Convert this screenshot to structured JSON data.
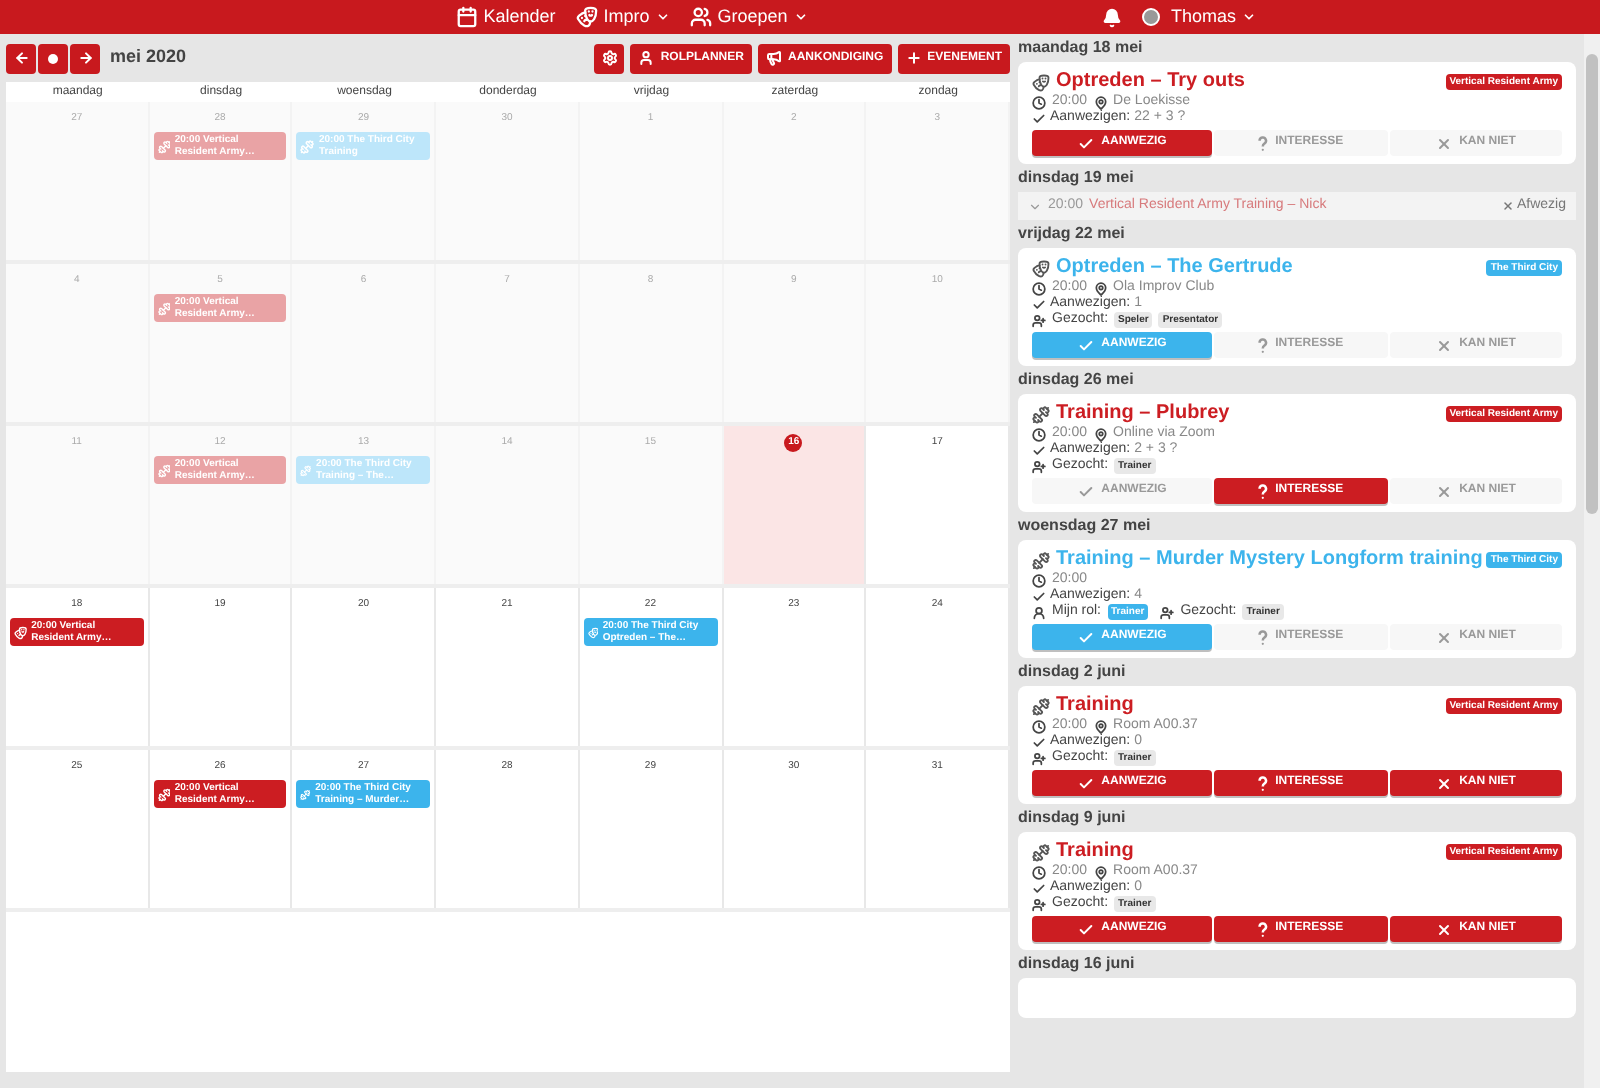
{
  "navbar": {
    "items": [
      {
        "label": "Kalender",
        "dropdown": false
      },
      {
        "label": "Impro",
        "dropdown": true
      },
      {
        "label": "Groepen",
        "dropdown": true
      }
    ],
    "user": {
      "name": "Thomas"
    }
  },
  "toolbar": {
    "month": "mei 2020",
    "buttons": [
      {
        "label": "ROLPLANNER"
      },
      {
        "label": "AANKONDIGING"
      },
      {
        "label": "EVENEMENT"
      }
    ]
  },
  "calendar": {
    "weekdays": [
      "maandag",
      "dinsdag",
      "woensdag",
      "donderdag",
      "vrijdag",
      "zaterdag",
      "zondag"
    ],
    "weeks": [
      [
        {
          "day": "27",
          "past": true,
          "today": false
        },
        {
          "day": "28",
          "past": true,
          "today": false,
          "events": [
            {
              "kind": "training",
              "text": "20:00 Vertical Resident Army…",
              "color": "#e9a3a5"
            }
          ]
        },
        {
          "day": "29",
          "past": true,
          "today": false,
          "events": [
            {
              "kind": "training",
              "text": "20:00 The Third City Training",
              "color": "#bde6fa"
            }
          ]
        },
        {
          "day": "30",
          "past": true,
          "today": false
        },
        {
          "day": "1",
          "past": true,
          "today": false
        },
        {
          "day": "2",
          "past": true,
          "today": false
        },
        {
          "day": "3",
          "past": true,
          "today": false
        }
      ],
      [
        {
          "day": "4",
          "past": true,
          "today": false
        },
        {
          "day": "5",
          "past": true,
          "today": false,
          "events": [
            {
              "kind": "training",
              "text": "20:00 Vertical Resident Army…",
              "color": "#e9a3a5"
            }
          ]
        },
        {
          "day": "6",
          "past": true,
          "today": false
        },
        {
          "day": "7",
          "past": true,
          "today": false
        },
        {
          "day": "8",
          "past": true,
          "today": false
        },
        {
          "day": "9",
          "past": true,
          "today": false
        },
        {
          "day": "10",
          "past": true,
          "today": false
        }
      ],
      [
        {
          "day": "11",
          "past": true,
          "today": false
        },
        {
          "day": "12",
          "past": true,
          "today": false,
          "events": [
            {
              "kind": "training",
              "text": "20:00 Vertical Resident Army…",
              "color": "#e9a3a5"
            }
          ]
        },
        {
          "day": "13",
          "past": true,
          "today": false,
          "events": [
            {
              "kind": "training",
              "text": "20:00 The Third City Training – The…",
              "color": "#bde6fa"
            }
          ]
        },
        {
          "day": "14",
          "past": true,
          "today": false
        },
        {
          "day": "15",
          "past": true,
          "today": false
        },
        {
          "day": "16",
          "past": false,
          "today": true
        },
        {
          "day": "17",
          "past": false,
          "today": false
        }
      ],
      [
        {
          "day": "18",
          "past": false,
          "today": false,
          "events": [
            {
              "kind": "performance",
              "text": "20:00 Vertical Resident Army…",
              "color": "#cc1d22"
            }
          ]
        },
        {
          "day": "19",
          "past": false,
          "today": false
        },
        {
          "day": "20",
          "past": false,
          "today": false
        },
        {
          "day": "21",
          "past": false,
          "today": false
        },
        {
          "day": "22",
          "past": false,
          "today": false,
          "events": [
            {
              "kind": "performance",
              "text": "20:00 The Third City Optreden – The…",
              "color": "#3cb4ec"
            }
          ]
        },
        {
          "day": "23",
          "past": false,
          "today": false
        },
        {
          "day": "24",
          "past": false,
          "today": false
        }
      ],
      [
        {
          "day": "25",
          "past": false,
          "today": false
        },
        {
          "day": "26",
          "past": false,
          "today": false,
          "events": [
            {
              "kind": "training",
              "text": "20:00 Vertical Resident Army…",
              "color": "#cc1d22"
            }
          ]
        },
        {
          "day": "27",
          "past": false,
          "today": false,
          "events": [
            {
              "kind": "training",
              "text": "20:00 The Third City Training – Murder…",
              "color": "#3cb4ec"
            }
          ]
        },
        {
          "day": "28",
          "past": false,
          "today": false
        },
        {
          "day": "29",
          "past": false,
          "today": false
        },
        {
          "day": "30",
          "past": false,
          "today": false
        },
        {
          "day": "31",
          "past": false,
          "today": false
        }
      ]
    ]
  },
  "agenda": [
    {
      "heading": "maandag 18 mei",
      "items": [
        {
          "kind": "performance",
          "title": "Optreden – Try outs",
          "color": "#cc1d22",
          "group": "Vertical Resident Army",
          "time": "20:00",
          "location": "De Loekisse",
          "attendance_label": "Aanwezigen:",
          "attendance": "22 + 3 ?",
          "responses": [
            {
              "kind": "yes",
              "label": "AANWEZIG",
              "selected": true
            },
            {
              "kind": "maybe",
              "label": "INTERESSE",
              "selected": false
            },
            {
              "kind": "no",
              "label": "KAN NIET",
              "selected": false
            }
          ]
        }
      ]
    },
    {
      "heading": "dinsdag 19 mei",
      "items": [
        {
          "kind": "collapsed",
          "time": "20:00",
          "title": "Vertical Resident Army Training – Nick",
          "status": "Afwezig"
        }
      ]
    },
    {
      "heading": "vrijdag 22 mei",
      "items": [
        {
          "kind": "performance",
          "title": "Optreden – The Gertrude",
          "color": "#3cb4ec",
          "group": "The Third City",
          "time": "20:00",
          "location": "Ola Improv Club",
          "attendance_label": "Aanwezigen:",
          "attendance": "1",
          "sought_label": "Gezocht:",
          "sought": [
            "Speler",
            "Presentator"
          ],
          "responses": [
            {
              "kind": "yes",
              "label": "AANWEZIG",
              "selected": true
            },
            {
              "kind": "maybe",
              "label": "INTERESSE",
              "selected": false
            },
            {
              "kind": "no",
              "label": "KAN NIET",
              "selected": false
            }
          ]
        }
      ]
    },
    {
      "heading": "dinsdag 26 mei",
      "items": [
        {
          "kind": "training",
          "title": "Training – Plubrey",
          "color": "#cc1d22",
          "group": "Vertical Resident Army",
          "time": "20:00",
          "location": "Online via Zoom",
          "attendance_label": "Aanwezigen:",
          "attendance": "2 + 3 ?",
          "sought_label": "Gezocht:",
          "sought": [
            "Trainer"
          ],
          "responses": [
            {
              "kind": "yes",
              "label": "AANWEZIG",
              "selected": false
            },
            {
              "kind": "maybe",
              "label": "INTERESSE",
              "selected": true
            },
            {
              "kind": "no",
              "label": "KAN NIET",
              "selected": false
            }
          ]
        }
      ]
    },
    {
      "heading": "woensdag 27 mei",
      "items": [
        {
          "kind": "training",
          "title": "Training – Murder Mystery Longform training",
          "color": "#3cb4ec",
          "group": "The Third City",
          "time": "20:00",
          "attendance_label": "Aanwezigen:",
          "attendance": "4",
          "role_label": "Mijn rol:",
          "role": "Trainer",
          "sought_label": "Gezocht:",
          "sought": [
            "Trainer"
          ],
          "responses": [
            {
              "kind": "yes",
              "label": "AANWEZIG",
              "selected": true
            },
            {
              "kind": "maybe",
              "label": "INTERESSE",
              "selected": false
            },
            {
              "kind": "no",
              "label": "KAN NIET",
              "selected": false
            }
          ]
        }
      ]
    },
    {
      "heading": "dinsdag 2 juni",
      "items": [
        {
          "kind": "training",
          "title": "Training",
          "color": "#cc1d22",
          "group": "Vertical Resident Army",
          "time": "20:00",
          "location": "Room A00.37",
          "attendance_label": "Aanwezigen:",
          "attendance": "0",
          "sought_label": "Gezocht:",
          "sought": [
            "Trainer"
          ],
          "responses": [
            {
              "kind": "yes",
              "label": "AANWEZIG",
              "selected": false
            },
            {
              "kind": "maybe",
              "label": "INTERESSE",
              "selected": false
            },
            {
              "kind": "no",
              "label": "KAN NIET",
              "selected": false
            }
          ]
        }
      ]
    },
    {
      "heading": "dinsdag 9 juni",
      "items": [
        {
          "kind": "training",
          "title": "Training",
          "color": "#cc1d22",
          "group": "Vertical Resident Army",
          "time": "20:00",
          "location": "Room A00.37",
          "attendance_label": "Aanwezigen:",
          "attendance": "0",
          "sought_label": "Gezocht:",
          "sought": [
            "Trainer"
          ],
          "responses": [
            {
              "kind": "yes",
              "label": "AANWEZIG",
              "selected": false
            },
            {
              "kind": "maybe",
              "label": "INTERESSE",
              "selected": false
            },
            {
              "kind": "no",
              "label": "KAN NIET",
              "selected": false
            }
          ]
        }
      ]
    },
    {
      "heading": "dinsdag 16 juni"
    }
  ]
}
